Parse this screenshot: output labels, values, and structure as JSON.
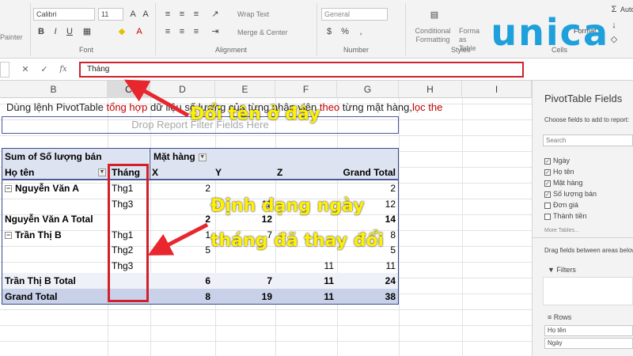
{
  "ribbon": {
    "paint_label": "Painter",
    "font_name": "Calibri",
    "font_size": "11",
    "font_label": "Font",
    "alignment_label": "Alignment",
    "wrap_text": "Wrap Text",
    "merge_center": "Merge & Center",
    "number_format": "General",
    "number_label": "Number",
    "conditional_formatting": "Conditional Formatting",
    "format_as_table": "Format as Table",
    "styles_label": "Styles",
    "cells_label": "Cells",
    "format_label": "Format",
    "autosum_label": "Auto"
  },
  "logo": "unica",
  "formula_bar": {
    "name_box": "",
    "fx_label": "fx",
    "content": "Tháng"
  },
  "columns": [
    "B",
    "C",
    "D",
    "E",
    "F",
    "G",
    "H",
    "I"
  ],
  "description": {
    "part1": "Dùng lệnh PivotTable ",
    "part2": "tổng hợp",
    "part3": " dữ liệu số lượng của từng nhân viên ",
    "part4": "theo",
    "part5": " từng mặt hàng,",
    "part6": "lọc the"
  },
  "drop_zone": "Drop Report Filter Fields Here",
  "pivot": {
    "value_header": "Sum of Số lượng bán",
    "col_field": "Mặt hàng",
    "row_field": "Họ tên",
    "month_field": "Tháng",
    "col_headers": [
      "X",
      "Y",
      "Z",
      "Grand Total"
    ],
    "rows": [
      {
        "name": "Nguyễn Văn A",
        "month": "Thg1",
        "values": [
          "2",
          "",
          "",
          "2"
        ],
        "expand": "⊟"
      },
      {
        "name": "",
        "month": "Thg3",
        "values": [
          "",
          "12",
          "",
          "12"
        ],
        "expand": ""
      },
      {
        "name": "Nguyễn Văn A Total",
        "month": "",
        "values": [
          "2",
          "12",
          "",
          "14"
        ],
        "expand": ""
      },
      {
        "name": "Trần Thị B",
        "month": "Thg1",
        "values": [
          "1",
          "7",
          "",
          "8"
        ],
        "expand": "⊟"
      },
      {
        "name": "",
        "month": "Thg2",
        "values": [
          "5",
          "",
          "",
          "5"
        ],
        "expand": ""
      },
      {
        "name": "",
        "month": "Thg3",
        "values": [
          "",
          "",
          "11",
          "11"
        ],
        "expand": ""
      },
      {
        "name": "Trần Thị B Total",
        "month": "",
        "values": [
          "6",
          "7",
          "11",
          "24"
        ],
        "expand": ""
      },
      {
        "name": "Grand Total",
        "month": "",
        "values": [
          "8",
          "19",
          "11",
          "38"
        ],
        "expand": ""
      }
    ]
  },
  "callouts": {
    "rename": "Đổi tên ở đây",
    "format_line1": "Định dạng ngày",
    "format_line2": "tháng đã thay đổi"
  },
  "panel": {
    "title": "PivotTable Fields",
    "subtitle": "Choose fields to add to report:",
    "search_placeholder": "Search",
    "fields": [
      {
        "label": "Ngày",
        "checked": true
      },
      {
        "label": "Họ tên",
        "checked": true
      },
      {
        "label": "Mặt hàng",
        "checked": true
      },
      {
        "label": "Số lượng bán",
        "checked": true
      },
      {
        "label": "Đơn giá",
        "checked": false
      },
      {
        "label": "Thành tiền",
        "checked": false
      }
    ],
    "more_tables": "More Tables...",
    "drag_text": "Drag fields between areas below:",
    "filters_label": "Filters",
    "rows_label": "Rows",
    "row_items": [
      "Họ tên",
      "Ngày"
    ]
  },
  "colors": {
    "accent_red": "#d0202a",
    "callout_yellow": "#fff100",
    "pivot_band": "#dde3f1",
    "pivot_border": "#3a4a8a",
    "logo_blue": "#1ea0dc"
  }
}
